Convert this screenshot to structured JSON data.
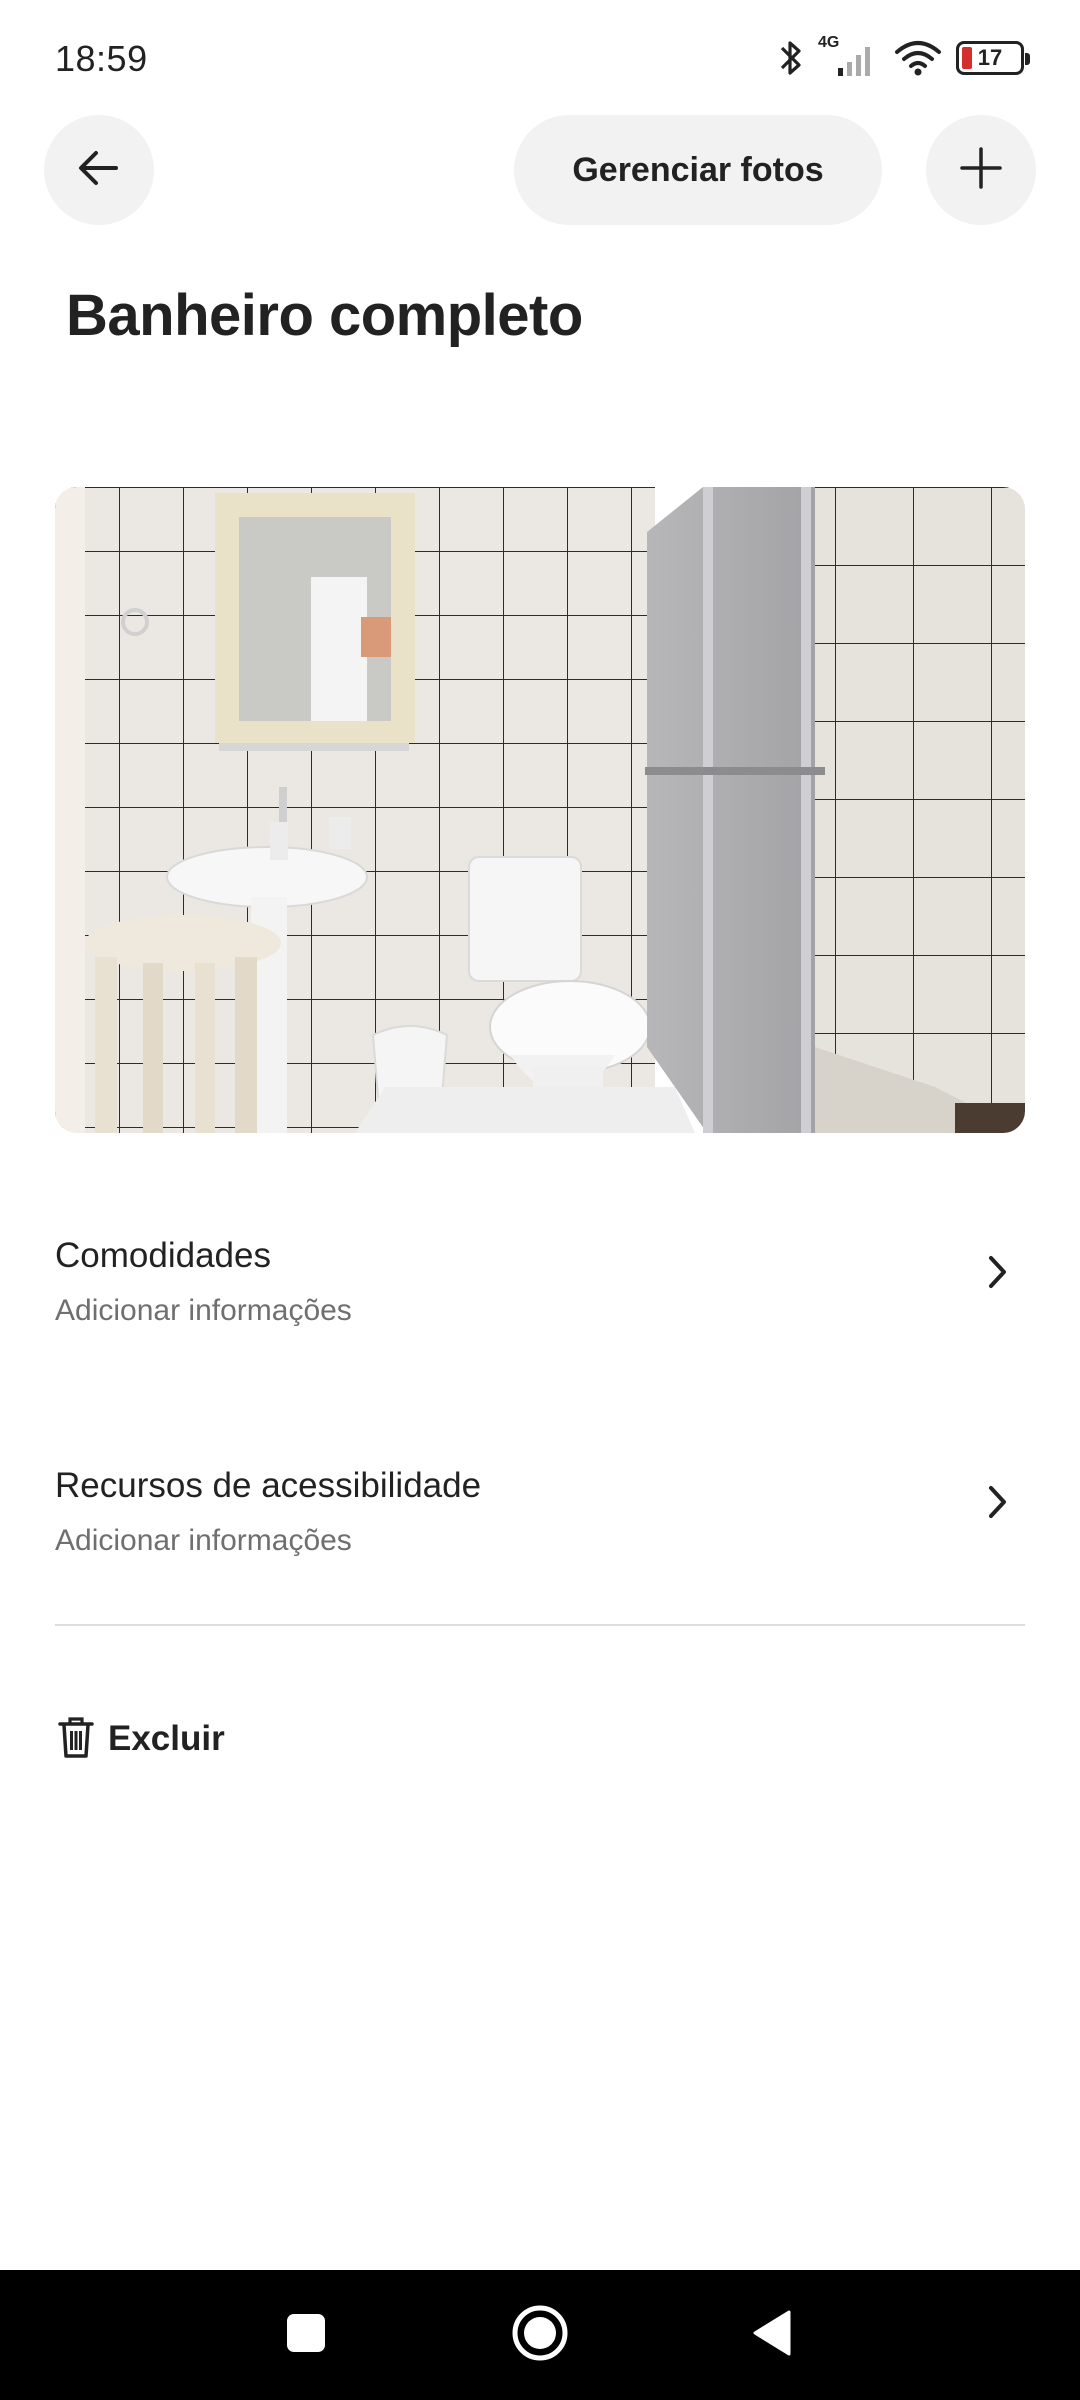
{
  "status_bar": {
    "time": "18:59",
    "network_label": "4G",
    "battery_level": "17",
    "icons": [
      "bluetooth-icon",
      "signal-icon",
      "wifi-icon",
      "battery-icon"
    ]
  },
  "header": {
    "back_icon": "arrow-left-icon",
    "manage_photos_label": "Gerenciar fotos",
    "add_icon": "plus-icon"
  },
  "page": {
    "title": "Banheiro completo"
  },
  "photo": {
    "subject": "bathroom-photo"
  },
  "sections": [
    {
      "title": "Comodidades",
      "subtitle": "Adicionar informações"
    },
    {
      "title": "Recursos de acessibilidade",
      "subtitle": "Adicionar informações"
    }
  ],
  "actions": {
    "delete_label": "Excluir",
    "delete_icon": "trash-icon"
  },
  "nav_bar": {
    "icons": [
      "recent-apps-icon",
      "home-icon",
      "back-triangle-icon"
    ]
  },
  "colors": {
    "text_primary": "#222222",
    "text_secondary": "#6f6f6f",
    "button_bg": "#f2f2f2",
    "divider": "#dddddd",
    "battery_low": "#d32f2f",
    "nav_bar_bg": "#000000"
  }
}
